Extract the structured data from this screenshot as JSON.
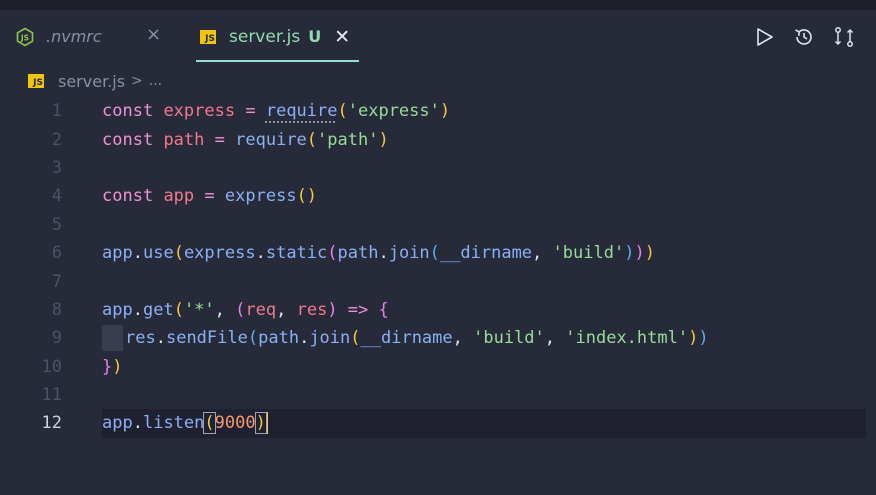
{
  "tabs": [
    {
      "label": ".nvmrc",
      "close": "×",
      "icon": "node-icon"
    },
    {
      "label": "server.js",
      "modified": "U",
      "close": "✕",
      "icon": "js-icon",
      "icon_text": "JS",
      "active": true
    }
  ],
  "actions": [
    "run-icon",
    "history-icon",
    "compare-icon"
  ],
  "breadcrumb": {
    "icon_text": "JS",
    "file": "server.js",
    "separator": ">",
    "more": "..."
  },
  "lines": [
    "1",
    "2",
    "3",
    "4",
    "5",
    "6",
    "7",
    "8",
    "9",
    "10",
    "11",
    "12"
  ],
  "code": {
    "l1": {
      "kw": "const",
      "name": "express",
      "eq": "=",
      "fn": "require",
      "open": "(",
      "str": "'express'",
      "close": ")"
    },
    "l2": {
      "kw": "const",
      "name": "path",
      "eq": "=",
      "fn": "require",
      "open": "(",
      "str": "'path'",
      "close": ")"
    },
    "l4": {
      "kw": "const",
      "name": "app",
      "eq": "=",
      "fn": "express",
      "parens": "()"
    },
    "l6": {
      "obj": "app",
      "dot1": ".",
      "fn1": "use",
      "o1": "(",
      "obj2": "express",
      "dot2": ".",
      "fn2": "static",
      "o2": "(",
      "obj3": "path",
      "dot3": ".",
      "fn3": "join",
      "o3": "(",
      "arg": "__dirname",
      "comma": ", ",
      "str": "'build'",
      "c3": ")",
      "c2": ")",
      "c1": ")"
    },
    "l8": {
      "obj": "app",
      "dot": ".",
      "fn": "get",
      "o1": "(",
      "str": "'*'",
      "comma": ", ",
      "o2": "(",
      "p1": "req",
      "comma2": ", ",
      "p2": "res",
      "c2": ")",
      "arrow": " => ",
      "brace": "{"
    },
    "l9": {
      "obj": "res",
      "dot": ".",
      "fn": "sendFile",
      "o1": "(",
      "obj2": "path",
      "dot2": ".",
      "fn2": "join",
      "o2": "(",
      "arg": "__dirname",
      "comma": ", ",
      "s1": "'build'",
      "comma2": ", ",
      "s2": "'index.html'",
      "c2": ")",
      "c1": ")"
    },
    "l10": {
      "brace": "}",
      "close": ")"
    },
    "l12": {
      "obj": "app",
      "dot": ".",
      "fn": "listen",
      "o1": "(",
      "num": "9000",
      "c1": ")"
    }
  },
  "colors": {
    "background": "#272a38",
    "accent": "#8fdfd2",
    "modified": "#95dbb1",
    "cursor": "#f6c744"
  }
}
